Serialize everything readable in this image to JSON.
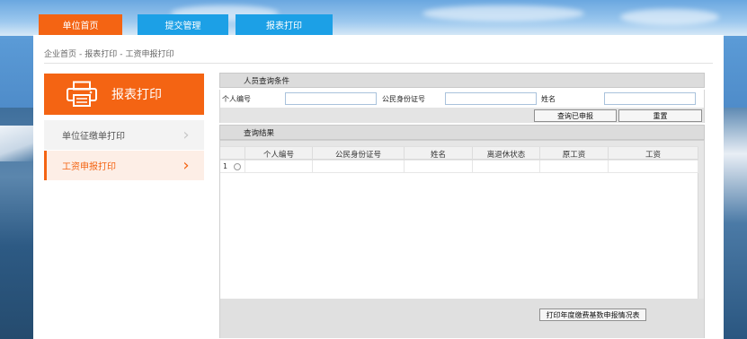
{
  "tabs": [
    {
      "label": "单位首页",
      "active": true
    },
    {
      "label": "提交管理",
      "active": false
    },
    {
      "label": "报表打印",
      "active": false
    }
  ],
  "breadcrumb": [
    "企业首页",
    "报表打印",
    "工资申报打印"
  ],
  "breadcrumb_sep": "-",
  "sidebar": {
    "title": "报表打印",
    "icon": "printer-icon",
    "items": [
      {
        "label": "单位征缴单打印",
        "active": false
      },
      {
        "label": "工资申报打印",
        "active": true
      }
    ]
  },
  "query": {
    "section_title": "人员查询条件",
    "fields": {
      "person_no_label": "个人编号",
      "person_no_value": "",
      "id_card_label": "公民身份证号",
      "id_card_value": "",
      "name_label": "姓名",
      "name_value": ""
    },
    "buttons": {
      "query_declared": "查询已申报",
      "reset": "重置"
    }
  },
  "results": {
    "section_title": "查询结果",
    "columns": [
      "个人编号",
      "公民身份证号",
      "姓名",
      "离退休状态",
      "原工资",
      "工资"
    ],
    "rows": [
      {
        "index": "1",
        "cells": [
          "",
          "",
          "",
          "",
          "",
          ""
        ]
      }
    ],
    "print_button": "打印年度缴费基数申报情况表"
  },
  "colors": {
    "accent_orange": "#f46413",
    "tab_blue": "#1ca0e6"
  }
}
